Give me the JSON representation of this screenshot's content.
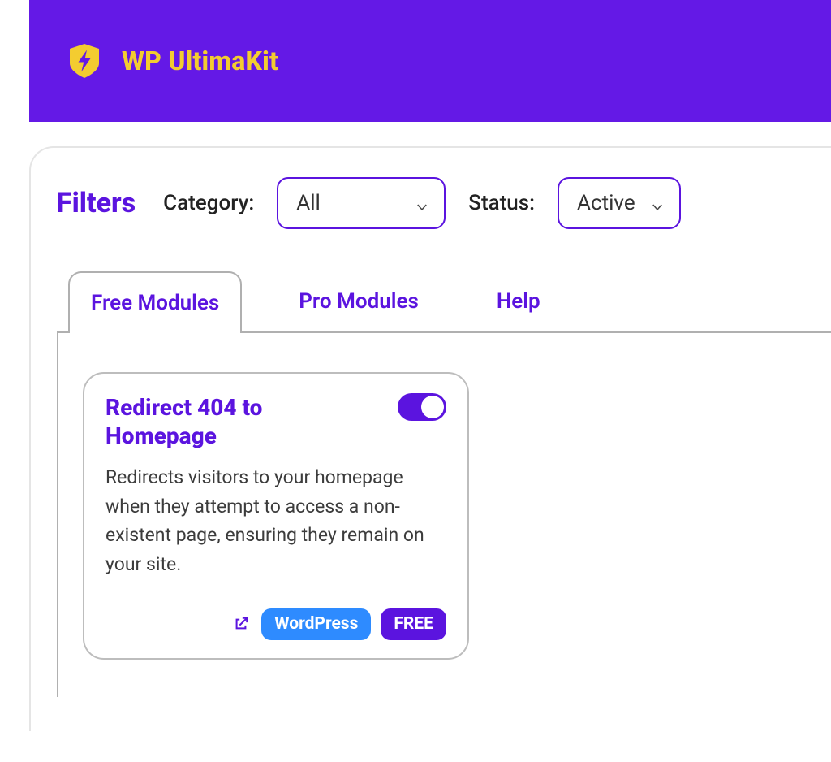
{
  "brand": {
    "name": "WP UltimaKit"
  },
  "filters": {
    "title": "Filters",
    "category_label": "Category:",
    "category_value": "All",
    "status_label": "Status:",
    "status_value": "Active"
  },
  "tabs": {
    "items": [
      {
        "label": "Free Modules",
        "active": true
      },
      {
        "label": "Pro Modules",
        "active": false
      },
      {
        "label": "Help",
        "active": false
      }
    ]
  },
  "module": {
    "title": "Redirect 404 to Homepage",
    "description": "Redirects visitors to your homepage when they attempt to access a non-existent page, ensuring they remain on your site.",
    "enabled": true,
    "tags": {
      "platform": "WordPress",
      "tier": "FREE"
    }
  }
}
